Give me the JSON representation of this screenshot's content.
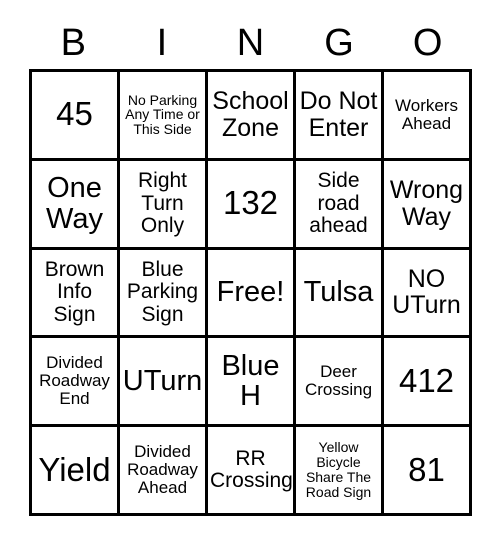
{
  "card": {
    "headers": [
      "B",
      "I",
      "N",
      "G",
      "O"
    ],
    "rows": [
      [
        {
          "text": "45",
          "size": "sz-xxl"
        },
        {
          "text": "No Parking Any Time or This Side",
          "size": "sz-xs"
        },
        {
          "text": "School Zone",
          "size": "sz-l"
        },
        {
          "text": "Do Not Enter",
          "size": "sz-l"
        },
        {
          "text": "Workers Ahead",
          "size": "sz-s"
        }
      ],
      [
        {
          "text": "One Way",
          "size": "sz-xl"
        },
        {
          "text": "Right Turn Only",
          "size": "sz-m"
        },
        {
          "text": "132",
          "size": "sz-xxl"
        },
        {
          "text": "Side road ahead",
          "size": "sz-m"
        },
        {
          "text": "Wrong Way",
          "size": "sz-l"
        }
      ],
      [
        {
          "text": "Brown Info Sign",
          "size": "sz-m"
        },
        {
          "text": "Blue Parking Sign",
          "size": "sz-m"
        },
        {
          "text": "Free!",
          "size": "sz-xl"
        },
        {
          "text": "Tulsa",
          "size": "sz-xl"
        },
        {
          "text": "NO UTurn",
          "size": "sz-l"
        }
      ],
      [
        {
          "text": "Divided Roadway End",
          "size": "sz-s"
        },
        {
          "text": "UTurn",
          "size": "sz-xl"
        },
        {
          "text": "Blue H",
          "size": "sz-xl"
        },
        {
          "text": "Deer Crossing",
          "size": "sz-s"
        },
        {
          "text": "412",
          "size": "sz-xxl"
        }
      ],
      [
        {
          "text": "Yield",
          "size": "sz-xxl"
        },
        {
          "text": "Divided Roadway Ahead",
          "size": "sz-s"
        },
        {
          "text": "RR Crossing",
          "size": "sz-m"
        },
        {
          "text": "Yellow Bicycle Share The Road Sign",
          "size": "sz-xs"
        },
        {
          "text": "81",
          "size": "sz-xxl"
        }
      ]
    ]
  }
}
